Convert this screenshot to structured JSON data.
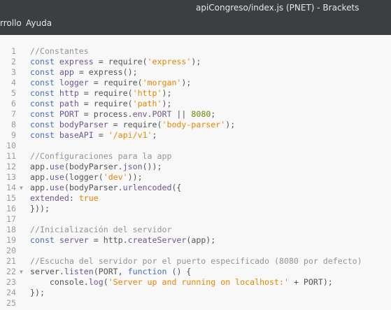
{
  "window": {
    "title": "apiCongreso/index.js (PNET) - Brackets"
  },
  "menu": {
    "items": [
      "rrollo",
      "Ayuda"
    ]
  },
  "colors": {
    "titlebar": "#3c3f41",
    "editor_bg": "#f8f8f8",
    "comment": "#949494",
    "keyword": "#446fbd",
    "string": "#e88501",
    "number": "#6d8600"
  },
  "editor": {
    "lines": [
      {
        "n": "1",
        "fold": false,
        "tokens": [
          {
            "t": "//Constantes",
            "c": "comment"
          }
        ]
      },
      {
        "n": "2",
        "fold": false,
        "tokens": [
          {
            "t": "const ",
            "c": "keyword"
          },
          {
            "t": "express",
            "c": "variable"
          },
          {
            "t": " = require(",
            "c": "plain"
          },
          {
            "t": "'express'",
            "c": "string"
          },
          {
            "t": ");",
            "c": "plain"
          }
        ]
      },
      {
        "n": "3",
        "fold": false,
        "tokens": [
          {
            "t": "const ",
            "c": "keyword"
          },
          {
            "t": "app",
            "c": "variable"
          },
          {
            "t": " = express();",
            "c": "plain"
          }
        ]
      },
      {
        "n": "4",
        "fold": false,
        "tokens": [
          {
            "t": "const ",
            "c": "keyword"
          },
          {
            "t": "logger",
            "c": "variable"
          },
          {
            "t": " = require(",
            "c": "plain"
          },
          {
            "t": "'morgan'",
            "c": "string"
          },
          {
            "t": ");",
            "c": "plain"
          }
        ]
      },
      {
        "n": "5",
        "fold": false,
        "tokens": [
          {
            "t": "const ",
            "c": "keyword"
          },
          {
            "t": "http",
            "c": "variable"
          },
          {
            "t": " = require(",
            "c": "plain"
          },
          {
            "t": "'http'",
            "c": "string"
          },
          {
            "t": ");",
            "c": "plain"
          }
        ]
      },
      {
        "n": "6",
        "fold": false,
        "tokens": [
          {
            "t": "const ",
            "c": "keyword"
          },
          {
            "t": "path",
            "c": "variable"
          },
          {
            "t": " = require(",
            "c": "plain"
          },
          {
            "t": "'path'",
            "c": "string"
          },
          {
            "t": ");",
            "c": "plain"
          }
        ]
      },
      {
        "n": "7",
        "fold": false,
        "tokens": [
          {
            "t": "const ",
            "c": "keyword"
          },
          {
            "t": "PORT",
            "c": "variable"
          },
          {
            "t": " = process.",
            "c": "plain"
          },
          {
            "t": "env",
            "c": "property"
          },
          {
            "t": ".",
            "c": "plain"
          },
          {
            "t": "PORT",
            "c": "property"
          },
          {
            "t": " || ",
            "c": "plain"
          },
          {
            "t": "8080",
            "c": "number"
          },
          {
            "t": ";",
            "c": "plain"
          }
        ]
      },
      {
        "n": "8",
        "fold": false,
        "tokens": [
          {
            "t": "const ",
            "c": "keyword"
          },
          {
            "t": "bodyParser",
            "c": "variable"
          },
          {
            "t": " = require(",
            "c": "plain"
          },
          {
            "t": "'body-parser'",
            "c": "string"
          },
          {
            "t": ");",
            "c": "plain"
          }
        ]
      },
      {
        "n": "9",
        "fold": false,
        "tokens": [
          {
            "t": "const ",
            "c": "keyword"
          },
          {
            "t": "baseAPI",
            "c": "variable"
          },
          {
            "t": " = ",
            "c": "plain"
          },
          {
            "t": "'/api/v1'",
            "c": "string"
          },
          {
            "t": ";",
            "c": "plain"
          }
        ]
      },
      {
        "n": "10",
        "fold": false,
        "tokens": []
      },
      {
        "n": "11",
        "fold": false,
        "tokens": [
          {
            "t": "//Configuraciones para la app",
            "c": "comment"
          }
        ]
      },
      {
        "n": "12",
        "fold": false,
        "tokens": [
          {
            "t": "app.",
            "c": "plain"
          },
          {
            "t": "use",
            "c": "property"
          },
          {
            "t": "(bodyParser.",
            "c": "plain"
          },
          {
            "t": "json",
            "c": "property"
          },
          {
            "t": "());",
            "c": "plain"
          }
        ]
      },
      {
        "n": "13",
        "fold": false,
        "tokens": [
          {
            "t": "app.",
            "c": "plain"
          },
          {
            "t": "use",
            "c": "property"
          },
          {
            "t": "(logger(",
            "c": "plain"
          },
          {
            "t": "'dev'",
            "c": "string"
          },
          {
            "t": "));",
            "c": "plain"
          }
        ]
      },
      {
        "n": "14",
        "fold": true,
        "tokens": [
          {
            "t": "app.",
            "c": "plain"
          },
          {
            "t": "use",
            "c": "property"
          },
          {
            "t": "(bodyParser.",
            "c": "plain"
          },
          {
            "t": "urlencoded",
            "c": "property"
          },
          {
            "t": "({",
            "c": "plain"
          }
        ]
      },
      {
        "n": "15",
        "fold": false,
        "tokens": [
          {
            "t": "extended",
            "c": "property"
          },
          {
            "t": ": ",
            "c": "plain"
          },
          {
            "t": "true",
            "c": "atom"
          }
        ]
      },
      {
        "n": "16",
        "fold": false,
        "tokens": [
          {
            "t": "}));",
            "c": "plain"
          }
        ]
      },
      {
        "n": "17",
        "fold": false,
        "tokens": []
      },
      {
        "n": "18",
        "fold": false,
        "tokens": [
          {
            "t": "//Inicialización del servidor",
            "c": "comment"
          }
        ]
      },
      {
        "n": "19",
        "fold": false,
        "tokens": [
          {
            "t": "const ",
            "c": "keyword"
          },
          {
            "t": "server",
            "c": "variable"
          },
          {
            "t": " = http.",
            "c": "plain"
          },
          {
            "t": "createServer",
            "c": "property"
          },
          {
            "t": "(app);",
            "c": "plain"
          }
        ]
      },
      {
        "n": "20",
        "fold": false,
        "tokens": []
      },
      {
        "n": "21",
        "fold": false,
        "tokens": [
          {
            "t": "//Escucha del servidor por el puerto especificado (8080 por defecto)",
            "c": "comment"
          }
        ]
      },
      {
        "n": "22",
        "fold": true,
        "tokens": [
          {
            "t": "server.",
            "c": "plain"
          },
          {
            "t": "listen",
            "c": "property"
          },
          {
            "t": "(PORT, ",
            "c": "plain"
          },
          {
            "t": "function",
            "c": "function"
          },
          {
            "t": " () {",
            "c": "plain"
          }
        ]
      },
      {
        "n": "23",
        "fold": false,
        "tokens": [
          {
            "t": "    console.",
            "c": "plain"
          },
          {
            "t": "log",
            "c": "property"
          },
          {
            "t": "(",
            "c": "plain"
          },
          {
            "t": "'Server up and running on localhost:'",
            "c": "string"
          },
          {
            "t": " + PORT);",
            "c": "plain"
          }
        ]
      },
      {
        "n": "24",
        "fold": false,
        "tokens": [
          {
            "t": "});",
            "c": "plain"
          }
        ]
      },
      {
        "n": "25",
        "fold": false,
        "tokens": []
      }
    ]
  }
}
